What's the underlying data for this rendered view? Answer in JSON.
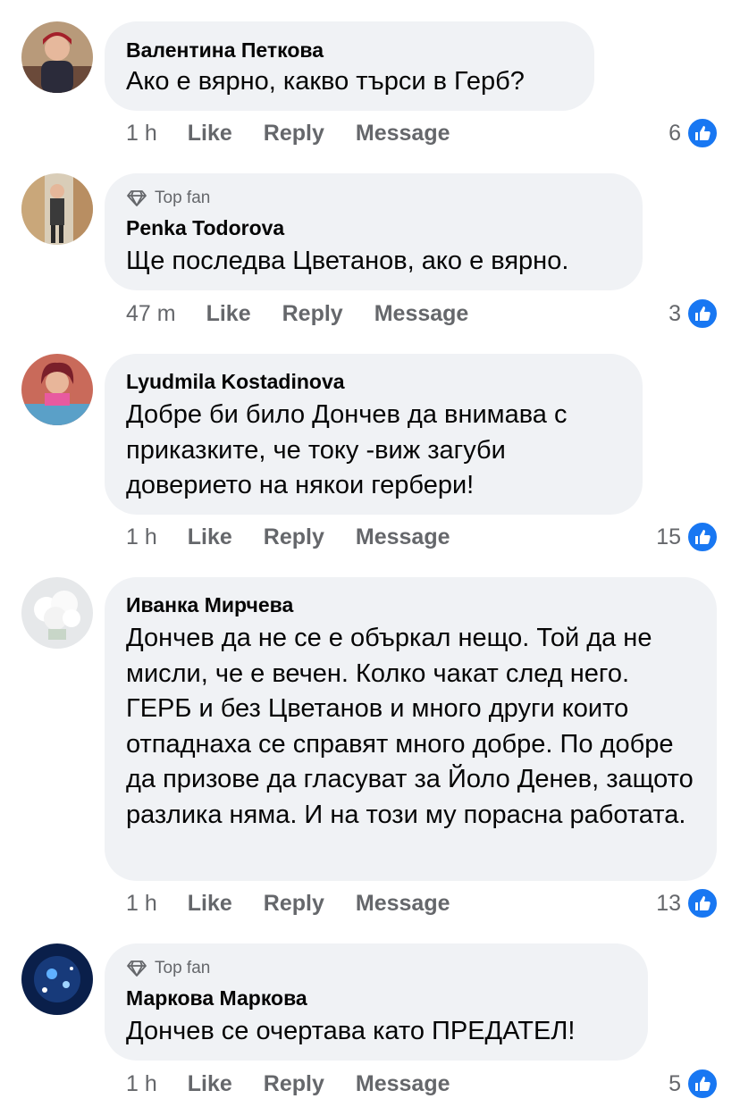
{
  "ui": {
    "like_icon": "thumbs-up-icon",
    "top_fan_icon": "diamond-icon",
    "colors": {
      "bubble": "#f0f2f5",
      "meta": "#65676b",
      "like": "#1877f2"
    }
  },
  "comments": [
    {
      "author": "Валентина Петкова",
      "top_fan": null,
      "text": "Ако е вярно, какво търси в Герб?",
      "time": "1 h",
      "like_label": "Like",
      "reply_label": "Reply",
      "message_label": "Message",
      "reaction_count": "6"
    },
    {
      "author": "Penka Todorova",
      "top_fan": "Top fan",
      "text": "Ще последва Цветанов, ако е вярно.",
      "time": "47 m",
      "like_label": "Like",
      "reply_label": "Reply",
      "message_label": "Message",
      "reaction_count": "3"
    },
    {
      "author": "Lyudmila Kostadinova",
      "top_fan": null,
      "text": "Добре би било Дончев да внимава с приказките, че току -виж загуби доверието на някои гербери!",
      "time": "1 h",
      "like_label": "Like",
      "reply_label": "Reply",
      "message_label": "Message",
      "reaction_count": "15"
    },
    {
      "author": "Иванка Мирчева",
      "top_fan": null,
      "text": "Дончев да не се е объркал нещо. Той да не мисли, че е вечен. Колко чакат след него. ГЕРБ и без Цветанов и много други които отпаднаха се справят много добре. По добре да призове да гласуват за Йоло Денев, защото разлика няма. И на този му порасна работата.",
      "time": "1 h",
      "like_label": "Like",
      "reply_label": "Reply",
      "message_label": "Message",
      "reaction_count": "13"
    },
    {
      "author": "Маркова Маркова",
      "top_fan": "Top fan",
      "text": "Дончев се очертава като ПРЕДАТЕЛ!",
      "time": "1 h",
      "like_label": "Like",
      "reply_label": "Reply",
      "message_label": "Message",
      "reaction_count": "5"
    }
  ]
}
